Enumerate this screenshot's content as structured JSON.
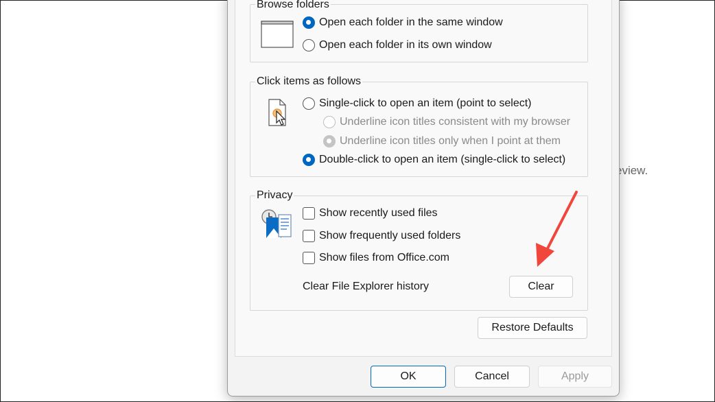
{
  "background": {
    "partial_text": "eview."
  },
  "browse_folders": {
    "legend": "Browse folders",
    "options": [
      {
        "label": "Open each folder in the same window",
        "checked": true
      },
      {
        "label": "Open each folder in its own window",
        "checked": false
      }
    ]
  },
  "click_items": {
    "legend": "Click items as follows",
    "single_click": "Single-click to open an item (point to select)",
    "underline_browser": "Underline icon titles consistent with my browser",
    "underline_point": "Underline icon titles only when I point at them",
    "double_click": "Double-click to open an item (single-click to select)"
  },
  "privacy": {
    "legend": "Privacy",
    "recent_files": "Show recently used files",
    "frequent_folders": "Show frequently used folders",
    "office_files": "Show files from Office.com",
    "clear_label": "Clear File Explorer history",
    "clear_button": "Clear"
  },
  "restore_defaults": "Restore Defaults",
  "footer": {
    "ok": "OK",
    "cancel": "Cancel",
    "apply": "Apply"
  },
  "colors": {
    "accent": "#0067c0",
    "annotation_arrow": "#f0463c"
  }
}
